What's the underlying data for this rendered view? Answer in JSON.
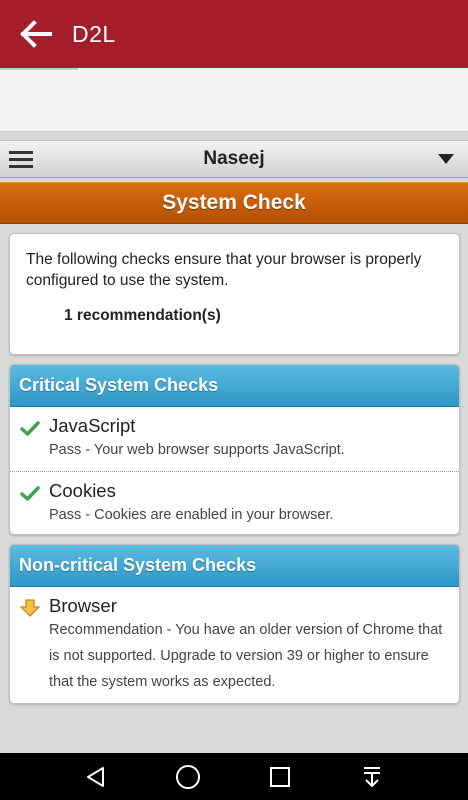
{
  "appbar": {
    "title": "D2L"
  },
  "selector": {
    "title": "Naseej"
  },
  "banner": {
    "title": "System Check"
  },
  "intro": {
    "text": "The following checks ensure that your browser is properly configured to use the system.",
    "recommendation_count": "1 recommendation(s)"
  },
  "critical": {
    "heading": "Critical System Checks",
    "items": [
      {
        "name": "JavaScript",
        "status": "pass",
        "description": "Pass - Your web browser supports JavaScript."
      },
      {
        "name": "Cookies",
        "status": "pass",
        "description": "Pass - Cookies are enabled in your browser."
      }
    ]
  },
  "noncritical": {
    "heading": "Non-critical System Checks",
    "items": [
      {
        "name": "Browser",
        "status": "recommendation",
        "description": "Recommendation - You have an older version of Chrome that is not supported. Upgrade to version 39 or higher to ensure that the system works as expected."
      }
    ]
  },
  "icons": {
    "back": "arrow-left-icon",
    "menu": "hamburger-icon",
    "dropdown": "caret-down-icon",
    "pass": "checkmark-icon",
    "recommendation": "arrow-down-icon",
    "nav": [
      "back-triangle-icon",
      "home-circle-icon",
      "recents-square-icon",
      "download-icon"
    ]
  },
  "colors": {
    "appbar": "#a51c2a",
    "banner": "#c85e0a",
    "section_header": "#3aa3d2",
    "pass": "#3fa34d",
    "recommendation": "#f0a81e"
  }
}
